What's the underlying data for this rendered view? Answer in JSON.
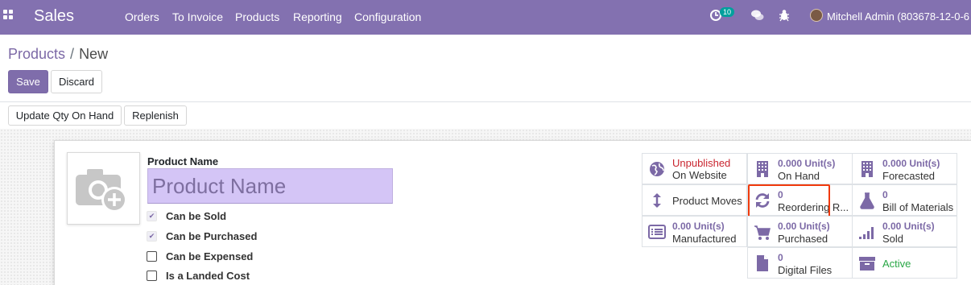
{
  "navbar": {
    "brand": "Sales",
    "menu": [
      "Orders",
      "To Invoice",
      "Products",
      "Reporting",
      "Configuration"
    ],
    "activity_count": "10",
    "user_name": "Mitchell Admin (803678-12-0-6"
  },
  "breadcrumb": {
    "parent": "Products",
    "separator": "/",
    "current": "New"
  },
  "buttons": {
    "save": "Save",
    "discard": "Discard",
    "update_qty": "Update Qty On Hand",
    "replenish": "Replenish"
  },
  "form": {
    "product_name_label": "Product Name",
    "product_name_placeholder": "Product Name",
    "checkboxes": [
      {
        "label": "Can be Sold",
        "checked": true
      },
      {
        "label": "Can be Purchased",
        "checked": true
      },
      {
        "label": "Can be Expensed",
        "checked": false
      },
      {
        "label": "Is a Landed Cost",
        "checked": false
      }
    ]
  },
  "smart_buttons": [
    {
      "value": "Unpublished",
      "label": "On Website",
      "icon": "globe-icon"
    },
    {
      "value": "0.000 Unit(s)",
      "label": "On Hand",
      "icon": "building-icon"
    },
    {
      "value": "0.000 Unit(s)",
      "label": "Forecasted",
      "icon": "building-icon"
    },
    {
      "value": "",
      "label": "Product Moves",
      "icon": "arrows-updown-icon"
    },
    {
      "value": "0",
      "label": "Reordering R...",
      "icon": "refresh-icon"
    },
    {
      "value": "0",
      "label": "Bill of Materials",
      "icon": "flask-icon"
    },
    {
      "value": "0.00 Unit(s)",
      "label": "Manufactured",
      "icon": "list-icon"
    },
    {
      "value": "0.00 Unit(s)",
      "label": "Purchased",
      "icon": "cart-icon"
    },
    {
      "value": "0.00 Unit(s)",
      "label": "Sold",
      "icon": "signal-icon"
    },
    {
      "value": "0",
      "label": "Digital Files",
      "icon": "file-icon"
    },
    {
      "value": "",
      "label": "Active",
      "icon": "archive-icon"
    }
  ],
  "colors": {
    "navbar": "#8371b0",
    "primary": "#7f6dab",
    "highlight": "#f03a0c",
    "unpublished": "#c9252f",
    "active": "#28a745"
  }
}
